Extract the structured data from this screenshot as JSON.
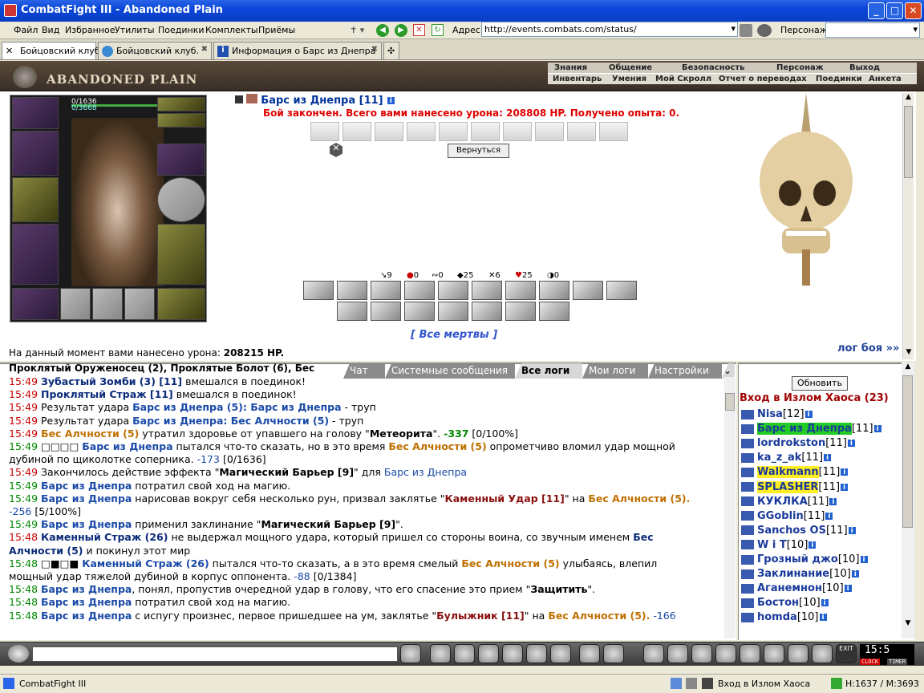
{
  "window": {
    "title": "CombatFight III - Abandoned Plain"
  },
  "menu": [
    "Файл",
    "Вид",
    "Избранное",
    "Утилиты",
    "Поединки",
    "Комплекты",
    "Приёмы"
  ],
  "address": {
    "label": "Адрес:",
    "url": "http://events.combats.com/status/"
  },
  "persona_label": "Персонаж:",
  "tabs": [
    {
      "label": "Бойцовский клуб"
    },
    {
      "label": "Бойцовский клуб."
    },
    {
      "label": "Информация о Барс из Днепра"
    }
  ],
  "game": {
    "location": "ABANDONED PLAIN",
    "nav_top": [
      "Знания",
      "Общение",
      "Безопасность",
      "Персонаж",
      "Выход"
    ],
    "nav_bottom": [
      "Инвентарь",
      "Умения",
      "Мой Скролл",
      "Отчет о переводах",
      "Поединки",
      "Анкета"
    ]
  },
  "char": {
    "hp": "0/1636",
    "mana": "0/3668"
  },
  "enemy": {
    "name": "Барс из Днепра [11]"
  },
  "battle": {
    "message": "Бой закончен. Всего вами нанесено урона: 208808 HP. Получено опыта: 0.",
    "return_label": "Вернуться",
    "stats": [
      "9",
      "0",
      "0",
      "25",
      "6",
      "25",
      "0"
    ],
    "all_dead": "[ Все мертвы ]",
    "damage_label": "На данный момент вами нанесено урона:",
    "damage_value": "208215 HP.",
    "log_link": "лог боя »»"
  },
  "chat": {
    "header": "Проклятый Оруженосец (2), Проклятые Болот (6), Бес",
    "tabs": [
      "Чат",
      "Системные сообщения",
      "Все логи",
      "Мои логи",
      "Настройки"
    ]
  },
  "log": [
    {
      "time": "15:49",
      "parts": [
        {
          "t": "Зубастый Зомби (3) [11]",
          "c": "nd"
        },
        {
          "t": " вмешался в поединок!",
          "c": ""
        }
      ]
    },
    {
      "time": "15:49",
      "parts": [
        {
          "t": "Проклятый Страж [11]",
          "c": "nd"
        },
        {
          "t": " вмешался в поединок!",
          "c": ""
        }
      ]
    },
    {
      "time": "15:49",
      "parts": [
        {
          "t": "Результат удара ",
          "c": ""
        },
        {
          "t": "Барс из Днепра (5): Барс из Днепра",
          "c": "nb"
        },
        {
          "t": " - труп",
          "c": ""
        }
      ]
    },
    {
      "time": "15:49",
      "parts": [
        {
          "t": "Результат удара ",
          "c": ""
        },
        {
          "t": "Барс из Днепра: Бес Алчности (5)",
          "c": "nb"
        },
        {
          "t": " - труп",
          "c": ""
        }
      ]
    },
    {
      "time": "15:49",
      "parts": [
        {
          "t": "Бес Алчности (5)",
          "c": "no"
        },
        {
          "t": " утратил здоровье от упавшего на голову \"",
          "c": ""
        },
        {
          "t": "Метеорита",
          "c": "b"
        },
        {
          "t": "\". ",
          "c": ""
        },
        {
          "t": "-337",
          "c": "vg"
        },
        {
          "t": " [0/100%]",
          "c": ""
        }
      ]
    },
    {
      "time": "15:49",
      "tg": true,
      "parts": [
        {
          "t": "□□□□ ",
          "c": ""
        },
        {
          "t": "Барс из Днепра",
          "c": "nb"
        },
        {
          "t": " пытался что-то сказать, но в это время ",
          "c": ""
        },
        {
          "t": "Бес Алчности (5)",
          "c": "no"
        },
        {
          "t": " опрометчиво вломил удар мощной",
          "c": ""
        }
      ]
    },
    {
      "time": "",
      "parts": [
        {
          "t": "дубиной по щиколотке соперника. ",
          "c": ""
        },
        {
          "t": "-173",
          "c": "vb"
        },
        {
          "t": " [0/1636]",
          "c": ""
        }
      ]
    },
    {
      "time": "15:49",
      "parts": [
        {
          "t": "Закончилось действие эффекта \"",
          "c": ""
        },
        {
          "t": "Магический Барьер [9]",
          "c": "b"
        },
        {
          "t": "\" для ",
          "c": ""
        },
        {
          "t": "Барс из Днепра",
          "c": "vb"
        }
      ]
    },
    {
      "time": "15:49",
      "tg": true,
      "parts": [
        {
          "t": "Барс из Днепра",
          "c": "nb"
        },
        {
          "t": " потратил свой ход на магию.",
          "c": ""
        }
      ]
    },
    {
      "time": "15:49",
      "tg": true,
      "parts": [
        {
          "t": "Барс из Днепра",
          "c": "nb"
        },
        {
          "t": " нарисовав вокруг себя несколько рун, призвал заклятье \"",
          "c": ""
        },
        {
          "t": "Каменный Удар [11]",
          "c": "nr"
        },
        {
          "t": "\" на ",
          "c": ""
        },
        {
          "t": "Бес Алчности (5).",
          "c": "no"
        }
      ]
    },
    {
      "time": "",
      "parts": [
        {
          "t": "-256",
          "c": "vb"
        },
        {
          "t": " [5/100%]",
          "c": ""
        }
      ]
    },
    {
      "time": "15:49",
      "tg": true,
      "parts": [
        {
          "t": "Барс из Днепра",
          "c": "nb"
        },
        {
          "t": " применил заклинание \"",
          "c": ""
        },
        {
          "t": "Магический Барьер [9]",
          "c": "b"
        },
        {
          "t": "\".",
          "c": ""
        }
      ]
    },
    {
      "time": "15:48",
      "parts": [
        {
          "t": "Каменный Страж (26)",
          "c": "nd"
        },
        {
          "t": " не выдержал мощного удара, который пришел со стороны воина, со звучным именем ",
          "c": ""
        },
        {
          "t": "Бес",
          "c": "nd"
        }
      ]
    },
    {
      "time": "",
      "parts": [
        {
          "t": "Алчности (5)",
          "c": "nd"
        },
        {
          "t": " и покинул этот мир",
          "c": ""
        }
      ]
    },
    {
      "time": "15:48",
      "tg": true,
      "parts": [
        {
          "t": "□■□■ ",
          "c": ""
        },
        {
          "t": "Каменный Страж (26)",
          "c": "nb"
        },
        {
          "t": " пытался что-то сказать, а в это время смелый ",
          "c": ""
        },
        {
          "t": "Бес Алчности (5)",
          "c": "no"
        },
        {
          "t": " улыбаясь, влепил",
          "c": ""
        }
      ]
    },
    {
      "time": "",
      "parts": [
        {
          "t": "мощный удар тяжелой дубиной в корпус оппонента. ",
          "c": ""
        },
        {
          "t": "-88",
          "c": "vb"
        },
        {
          "t": " [0/1384]",
          "c": ""
        }
      ]
    },
    {
      "time": "15:48",
      "tg": true,
      "parts": [
        {
          "t": "Барс из Днепра",
          "c": "nb"
        },
        {
          "t": ", понял, пропустив очередной удар в голову, что его спасение это прием \"",
          "c": ""
        },
        {
          "t": "Защитить",
          "c": "b"
        },
        {
          "t": "\".",
          "c": ""
        }
      ]
    },
    {
      "time": "15:48",
      "tg": true,
      "parts": [
        {
          "t": "Барс из Днепра",
          "c": "nb"
        },
        {
          "t": " потратил свой ход на магию.",
          "c": ""
        }
      ]
    },
    {
      "time": "15:48",
      "tg": true,
      "parts": [
        {
          "t": "Барс из Днепра",
          "c": "nb"
        },
        {
          "t": " с испугу произнес, первое пришедшее на ум, заклятье \"",
          "c": ""
        },
        {
          "t": "Булыжник [11]",
          "c": "nr"
        },
        {
          "t": "\" на ",
          "c": ""
        },
        {
          "t": "Бес Алчности (5).",
          "c": "no"
        },
        {
          "t": " -166",
          "c": "vb"
        }
      ]
    }
  ],
  "room": {
    "refresh": "Обновить",
    "title": "Вход в Излом Хаоса (23)",
    "users": [
      {
        "name": "Nisa",
        "level": "[12]"
      },
      {
        "name": "Барс из Днепра",
        "level": "[11]",
        "highlight": "#22cc22"
      },
      {
        "name": "lordrokston",
        "level": "[11]"
      },
      {
        "name": "ka_z_ak",
        "level": "[11]"
      },
      {
        "name": "Walkmann",
        "level": "[11]",
        "highlight": "#ffee22"
      },
      {
        "name": "SPLASHER",
        "level": "[11]",
        "highlight": "#ffee22"
      },
      {
        "name": "КУКЛКА",
        "level": "[11]"
      },
      {
        "name": "GGoblin",
        "level": "[11]"
      },
      {
        "name": "Sanchos OS",
        "level": "[11]"
      },
      {
        "name": "W i T",
        "level": "[10]"
      },
      {
        "name": "Грозный джо",
        "level": "[10]"
      },
      {
        "name": "Заклинание",
        "level": "[10]"
      },
      {
        "name": "Аганемнон",
        "level": "[10]"
      },
      {
        "name": "Бостон",
        "level": "[10]"
      },
      {
        "name": "homda",
        "level": "[10]"
      }
    ]
  },
  "clock": {
    "time": "15:5",
    "clock_label": "CLOCK",
    "timer_label": "TIMER"
  },
  "status": {
    "left": "CombatFight III",
    "room": "Вход в Излом Хаоса",
    "hm": "H:1637 / M:3693"
  },
  "colors": {
    "titlebar": "#0a46d8",
    "damage_red": "#e00000",
    "link_blue": "#1a4aa8",
    "room_title": "#a00000"
  }
}
